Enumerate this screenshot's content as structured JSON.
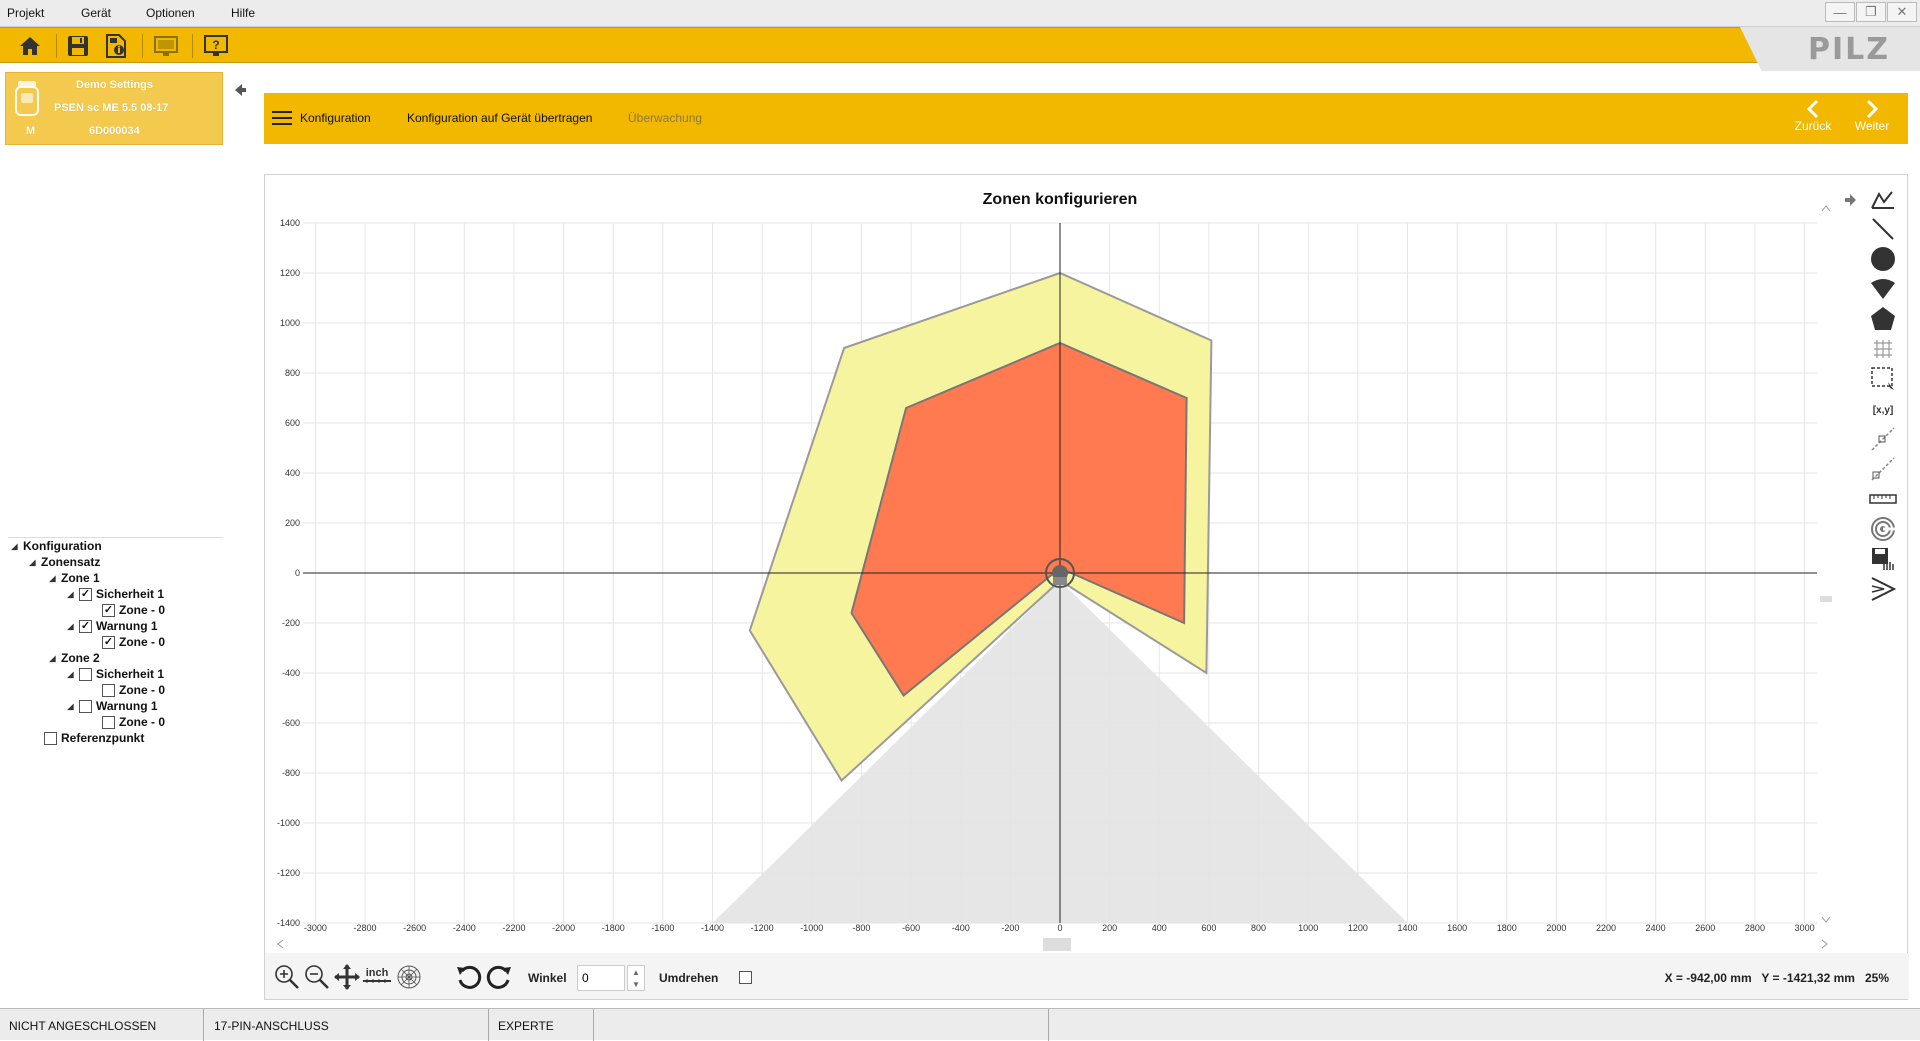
{
  "menu": {
    "items": [
      "Projekt",
      "Gerät",
      "Optionen",
      "Hilfe"
    ]
  },
  "window_controls": {
    "minimize": "—",
    "restore": "❐",
    "close": "✕"
  },
  "brand": {
    "logo": "PILZ",
    "accent": "#f2b800",
    "accent_light": "#f3c94e"
  },
  "toolbar": {
    "icons": [
      "home-icon",
      "save-icon",
      "save-info-icon",
      "monitor-icon",
      "help-monitor-icon"
    ]
  },
  "device": {
    "name": "Demo Settings",
    "model": "PSEN sc ME 5.5 08-17",
    "mode": "M",
    "serial": "6D000034"
  },
  "nav": {
    "menu_label": "Konfiguration",
    "transfer_label": "Konfiguration auf Gerät übertragen",
    "monitor_label": "Überwachung",
    "back_label": "Zurück",
    "next_label": "Weiter"
  },
  "tree": {
    "root": "Konfiguration",
    "zonenset": "Zonensatz",
    "zone1": "Zone 1",
    "z1_safety": "Sicherheit 1",
    "z1_safety_zone": "Zone - 0",
    "z1_warning": "Warnung 1",
    "z1_warning_zone": "Zone - 0",
    "zone2": "Zone 2",
    "z2_safety": "Sicherheit 1",
    "z2_safety_zone": "Zone - 0",
    "z2_warning": "Warnung 1",
    "z2_warning_zone": "Zone - 0",
    "reference": "Referenzpunkt",
    "checked": {
      "z1_safety": true,
      "z1_safety_zone": true,
      "z1_warning": true,
      "z1_warning_zone": true,
      "z2_safety": false,
      "z2_safety_zone": false,
      "z2_warning": false,
      "z2_warning_zone": false,
      "reference": false
    }
  },
  "plot": {
    "title": "Zonen konfigurieren",
    "x_ticks": [
      -3000,
      -2800,
      -2600,
      -2400,
      -2200,
      -2000,
      -1800,
      -1600,
      -1400,
      -1200,
      -1000,
      -800,
      -600,
      -400,
      -200,
      0,
      200,
      400,
      600,
      800,
      1000,
      1200,
      1400,
      1600,
      1800,
      2000,
      2200,
      2400,
      2600,
      2800,
      3000
    ],
    "y_ticks": [
      1400,
      1200,
      1000,
      800,
      600,
      400,
      200,
      0,
      -200,
      -400,
      -600,
      -800,
      -1000,
      -1200,
      -1400
    ],
    "xlim": [
      -3050,
      3050
    ],
    "ylim": [
      -1400,
      1400
    ],
    "warning_zone_color": "#f7f4a0",
    "safety_zone_color": "#ff7a50",
    "field_of_view_color": "#e3e3e3",
    "warning_zone": [
      [
        -870,
        900
      ],
      [
        0,
        1200
      ],
      [
        610,
        930
      ],
      [
        590,
        -400
      ],
      [
        0,
        -30
      ],
      [
        -880,
        -830
      ],
      [
        -1250,
        -230
      ]
    ],
    "safety_zone": [
      [
        -620,
        660
      ],
      [
        0,
        920
      ],
      [
        510,
        700
      ],
      [
        500,
        -200
      ],
      [
        0,
        20
      ],
      [
        -630,
        -490
      ],
      [
        -840,
        -160
      ]
    ],
    "field_of_view": [
      [
        0,
        -30
      ],
      [
        -1400,
        -1400
      ],
      [
        1400,
        -1400
      ]
    ]
  },
  "tools": {
    "right": [
      "polyline-draw-icon",
      "line-icon",
      "circle-icon",
      "sector-icon",
      "pentagon-icon",
      "grid-snap-icon",
      "select-rect-icon",
      "coordinates-icon",
      "edge-edit-icon",
      "edge-move-icon",
      "ruler-icon",
      "radar-icon",
      "save-zone-icon",
      "mirror-icon"
    ],
    "coordinates_label": "[x,y]",
    "unit_label": "inch"
  },
  "bottom": {
    "angle_label": "Winkel",
    "angle_value": "0",
    "flip_label": "Umdrehen",
    "coords": "X = -942,00 mm   Y = -1421,32 mm",
    "zoom": "25%"
  },
  "status": {
    "connection": "NICHT ANGESCHLOSSEN",
    "connector": "17-PIN-ANSCHLUSS",
    "user_level": "EXPERTE"
  }
}
